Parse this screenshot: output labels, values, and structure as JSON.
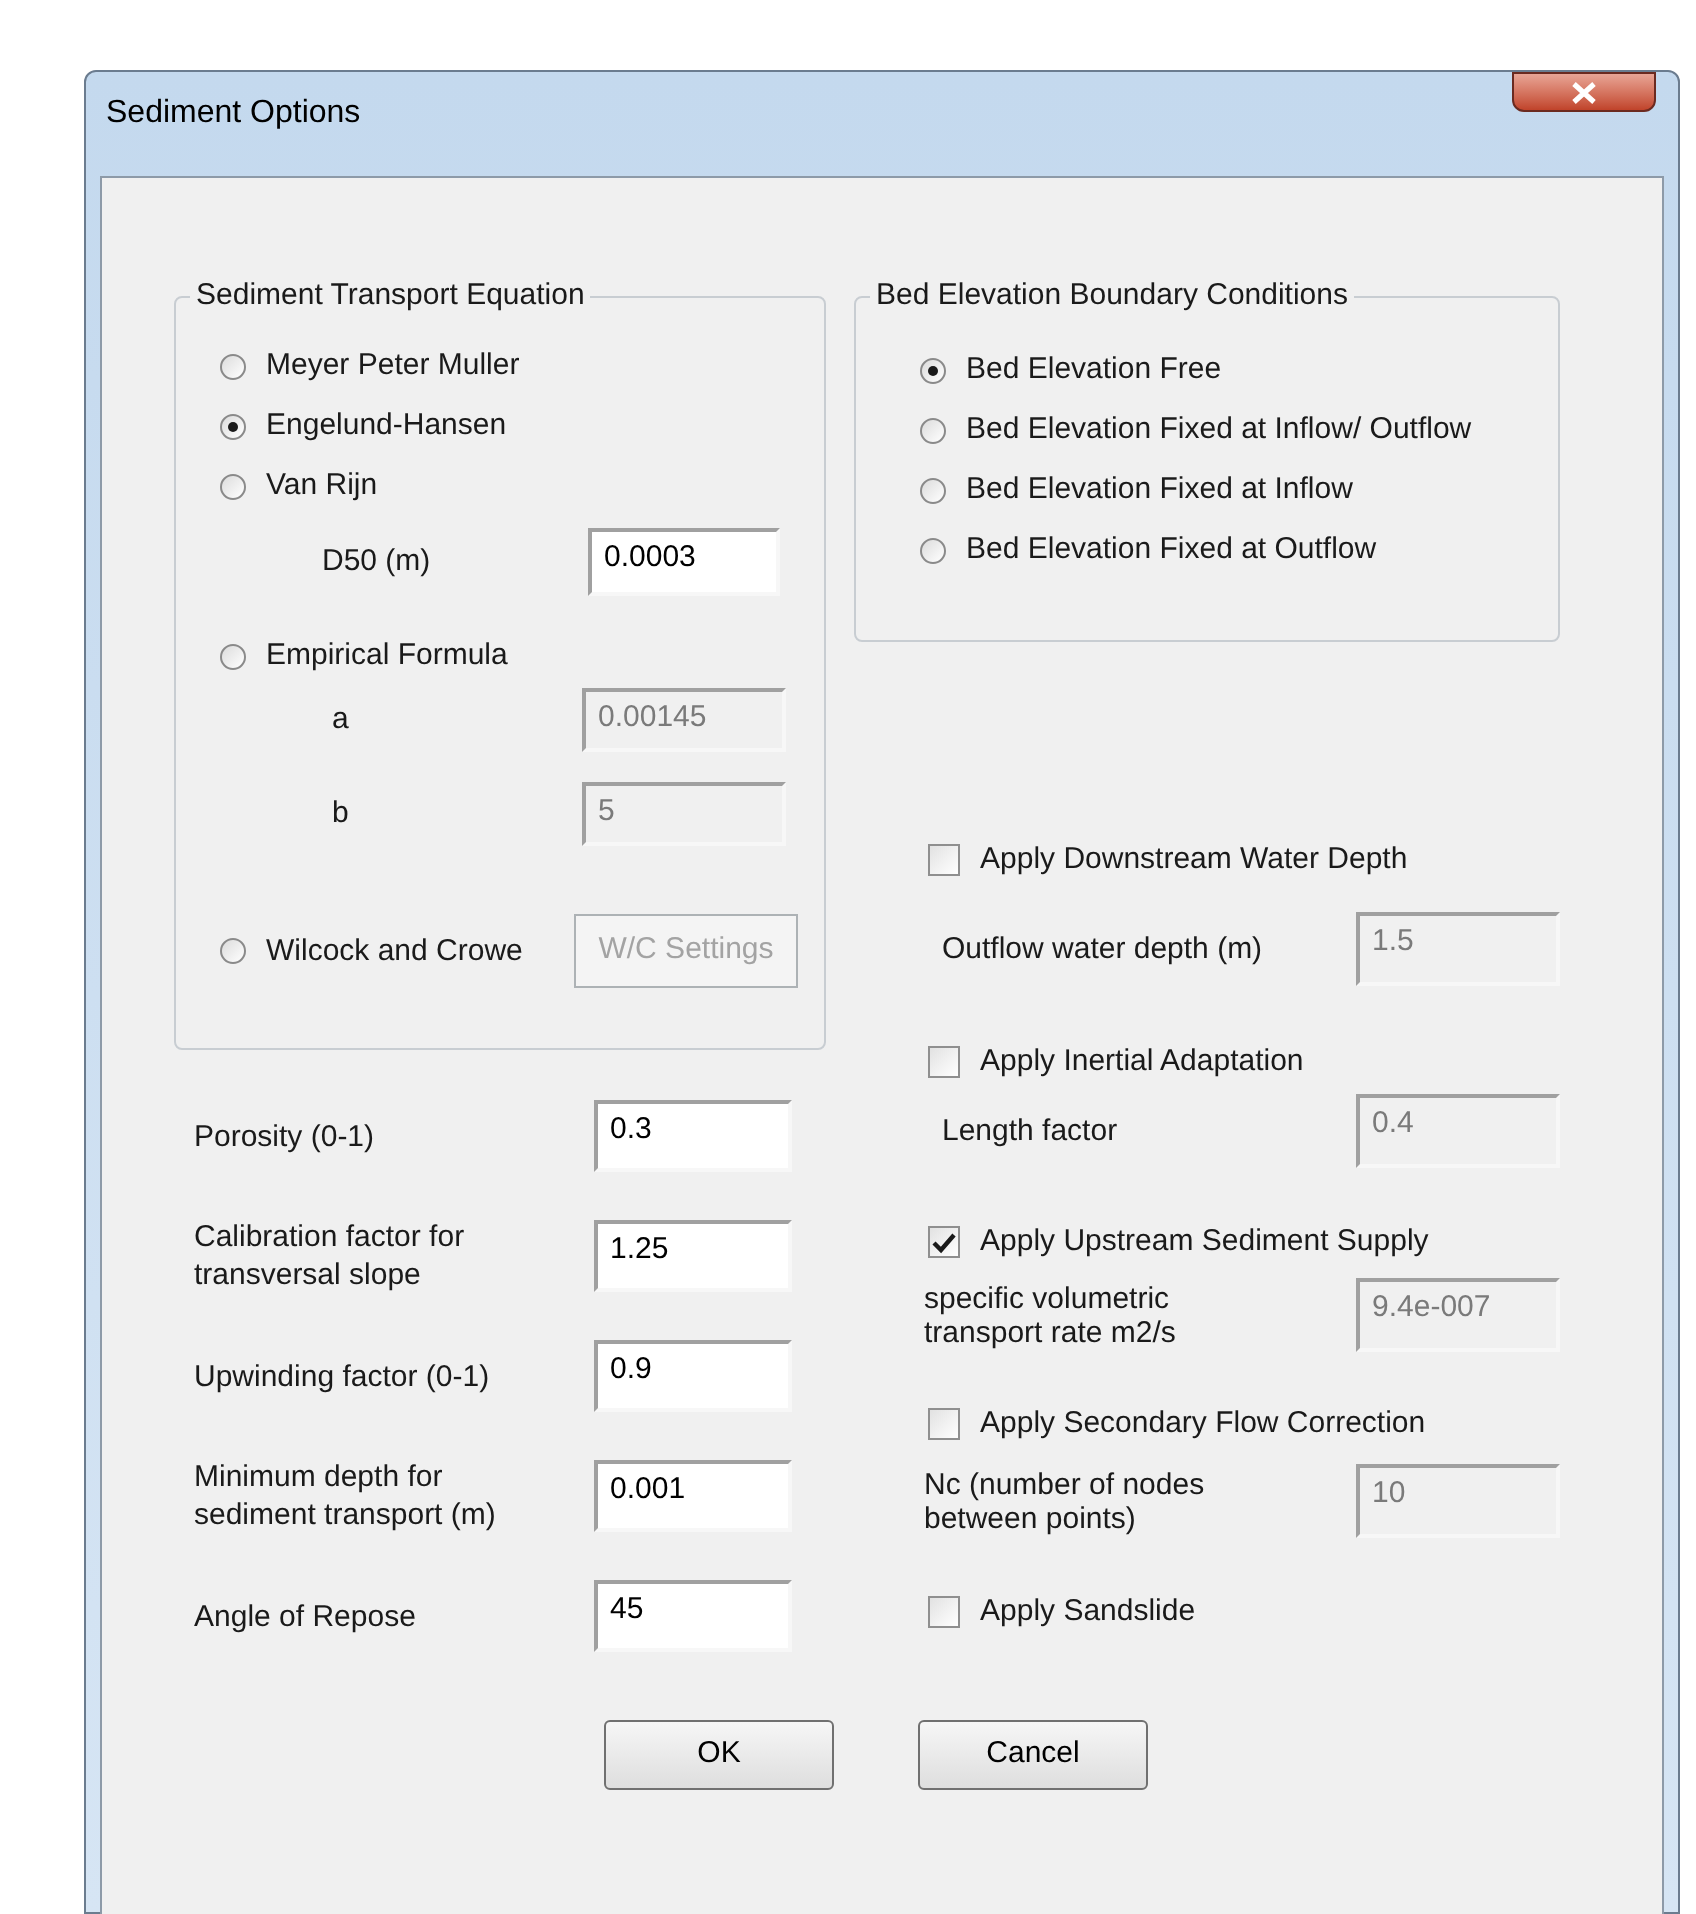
{
  "window": {
    "title": "Sediment Options"
  },
  "transport_equation": {
    "title": "Sediment Transport Equation",
    "options": [
      {
        "label": "Meyer Peter Muller",
        "selected": false
      },
      {
        "label": "Engelund-Hansen",
        "selected": true
      },
      {
        "label": "Van Rijn",
        "selected": false,
        "params": [
          {
            "label": "D50 (m)",
            "value": "0.0003",
            "disabled": false
          }
        ]
      },
      {
        "label": "Empirical Formula",
        "selected": false,
        "params": [
          {
            "label": "a",
            "value": "0.00145",
            "disabled": true
          },
          {
            "label": "b",
            "value": "5",
            "disabled": true
          }
        ]
      },
      {
        "label": "Wilcock and Crowe",
        "selected": false,
        "button": {
          "label": "W/C Settings",
          "disabled": true
        }
      }
    ]
  },
  "bed_boundary": {
    "title": "Bed Elevation Boundary Conditions",
    "options": [
      {
        "label": "Bed Elevation Free",
        "selected": true
      },
      {
        "label": "Bed Elevation Fixed at Inflow/ Outflow",
        "selected": false
      },
      {
        "label": "Bed Elevation Fixed at Inflow",
        "selected": false
      },
      {
        "label": "Bed Elevation Fixed at Outflow",
        "selected": false
      }
    ]
  },
  "parameters": [
    {
      "label": "Porosity (0-1)",
      "value": "0.3"
    },
    {
      "label": "Calibration factor for transversal slope",
      "value": "1.25"
    },
    {
      "label": "Upwinding factor (0-1)",
      "value": "0.9"
    },
    {
      "label": "Minimum depth for sediment transport (m)",
      "value": "0.001"
    },
    {
      "label": "Angle of Repose",
      "value": "45"
    }
  ],
  "options": [
    {
      "label": "Apply Downstream Water Depth",
      "checked": false,
      "field": {
        "label": "Outflow water depth (m)",
        "value": "1.5",
        "disabled": true
      }
    },
    {
      "label": "Apply Inertial Adaptation",
      "checked": false,
      "field": {
        "label": "Length factor",
        "value": "0.4",
        "disabled": true
      }
    },
    {
      "label": "Apply Upstream Sediment Supply",
      "checked": true,
      "field": {
        "label": "specific volumetric transport rate m2/s",
        "value": "9.4e-007",
        "disabled": true
      }
    },
    {
      "label": "Apply Secondary Flow Correction",
      "checked": false,
      "field": {
        "label": "Nc (number of nodes between points)",
        "value": "10",
        "disabled": true
      }
    },
    {
      "label": "Apply Sandslide",
      "checked": false
    }
  ],
  "buttons": [
    "OK",
    "Cancel"
  ]
}
